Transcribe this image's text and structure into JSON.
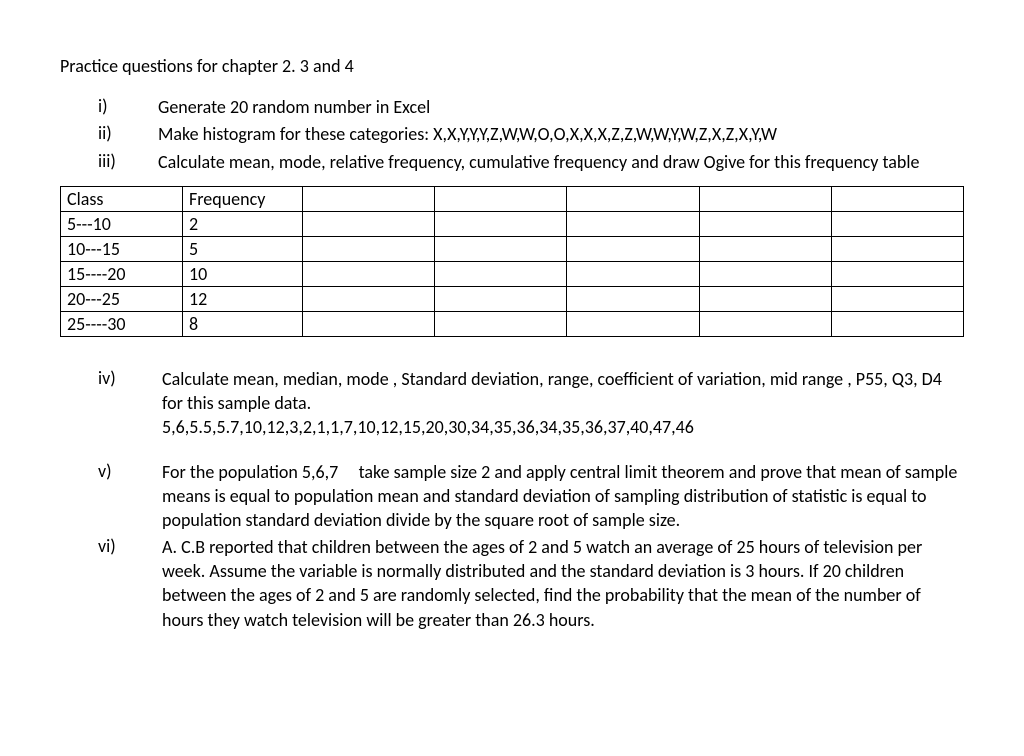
{
  "title": "Practice questions for chapter 2. 3 and 4",
  "list1": {
    "i": {
      "label": "i)",
      "text": "Generate 20 random number in Excel"
    },
    "ii": {
      "label": "ii)",
      "text": "Make histogram for these categories: X,X,Y,Y,Y,Z,W,W,O,O,X,X,X,Z,Z,W,W,Y,W,Z,X,Z,X,Y,W"
    },
    "iii": {
      "label": "iii)",
      "text": "Calculate mean, mode, relative frequency, cumulative frequency and draw Ogive for this frequency table"
    }
  },
  "table": {
    "header": {
      "c1": "Class",
      "c2": "Frequency"
    },
    "rows": [
      {
        "c1": "5---10",
        "c2": "2"
      },
      {
        "c1": "10---15",
        "c2": "5"
      },
      {
        "c1": "15----20",
        "c2": "10"
      },
      {
        "c1": "20---25",
        "c2": "12"
      },
      {
        "c1": "25----30",
        "c2": "8"
      }
    ]
  },
  "list2": {
    "iv": {
      "label": "iv)",
      "text": "Calculate mean, median, mode , Standard deviation, range, coefficient of variation, mid range , P55, Q3, D4 for this sample data.",
      "data": "5,6,5.5,5.7,10,12,3,2,1,1,7,10,12,15,20,30,34,35,36,34,35,36,37,40,47,46"
    },
    "v": {
      "label": "v)",
      "text": "For the population 5,6,7     take sample size 2 and apply central limit theorem and prove that mean of sample means is equal to population mean and standard deviation of sampling distribution of statistic is equal to population standard deviation divide by the square root of sample size."
    },
    "vi": {
      "label": "vi)",
      "text": "A. C.B  reported that children between the ages of 2 and 5 watch an average of 25 hours of television per week. Assume the variable is normally distributed and the standard deviation is 3 hours. If 20 children between the ages of 2 and 5 are randomly selected, find the probability that the mean of the number of hours they watch television will be greater than 26.3 hours."
    }
  }
}
